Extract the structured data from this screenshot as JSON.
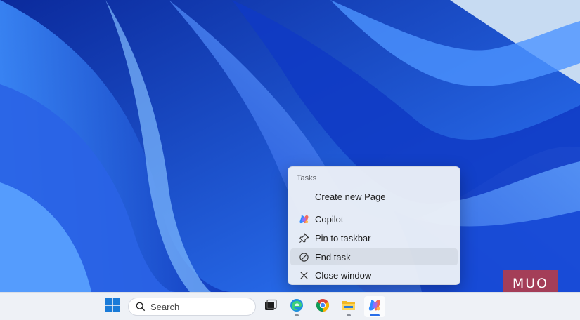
{
  "menu": {
    "header": "Tasks",
    "items": [
      {
        "label": "Create new Page",
        "icon": "none"
      },
      {
        "label": "Copilot",
        "icon": "copilot-icon"
      },
      {
        "label": "Pin to taskbar",
        "icon": "pin-icon"
      },
      {
        "label": "End task",
        "icon": "end-task-icon"
      },
      {
        "label": "Close window",
        "icon": "close-icon"
      }
    ]
  },
  "taskbar": {
    "search_placeholder": "Search",
    "apps": [
      "start-icon",
      "task-view-icon",
      "edge-icon",
      "chrome-icon",
      "file-explorer-icon",
      "copilot-app-icon"
    ]
  },
  "watermark": "MUO",
  "colors": {
    "accent": "#2a6ee8",
    "menu_bg": "#ecf0f7",
    "watermark_bg": "#c33c3c",
    "taskbar_bg": "#eef1f6"
  }
}
